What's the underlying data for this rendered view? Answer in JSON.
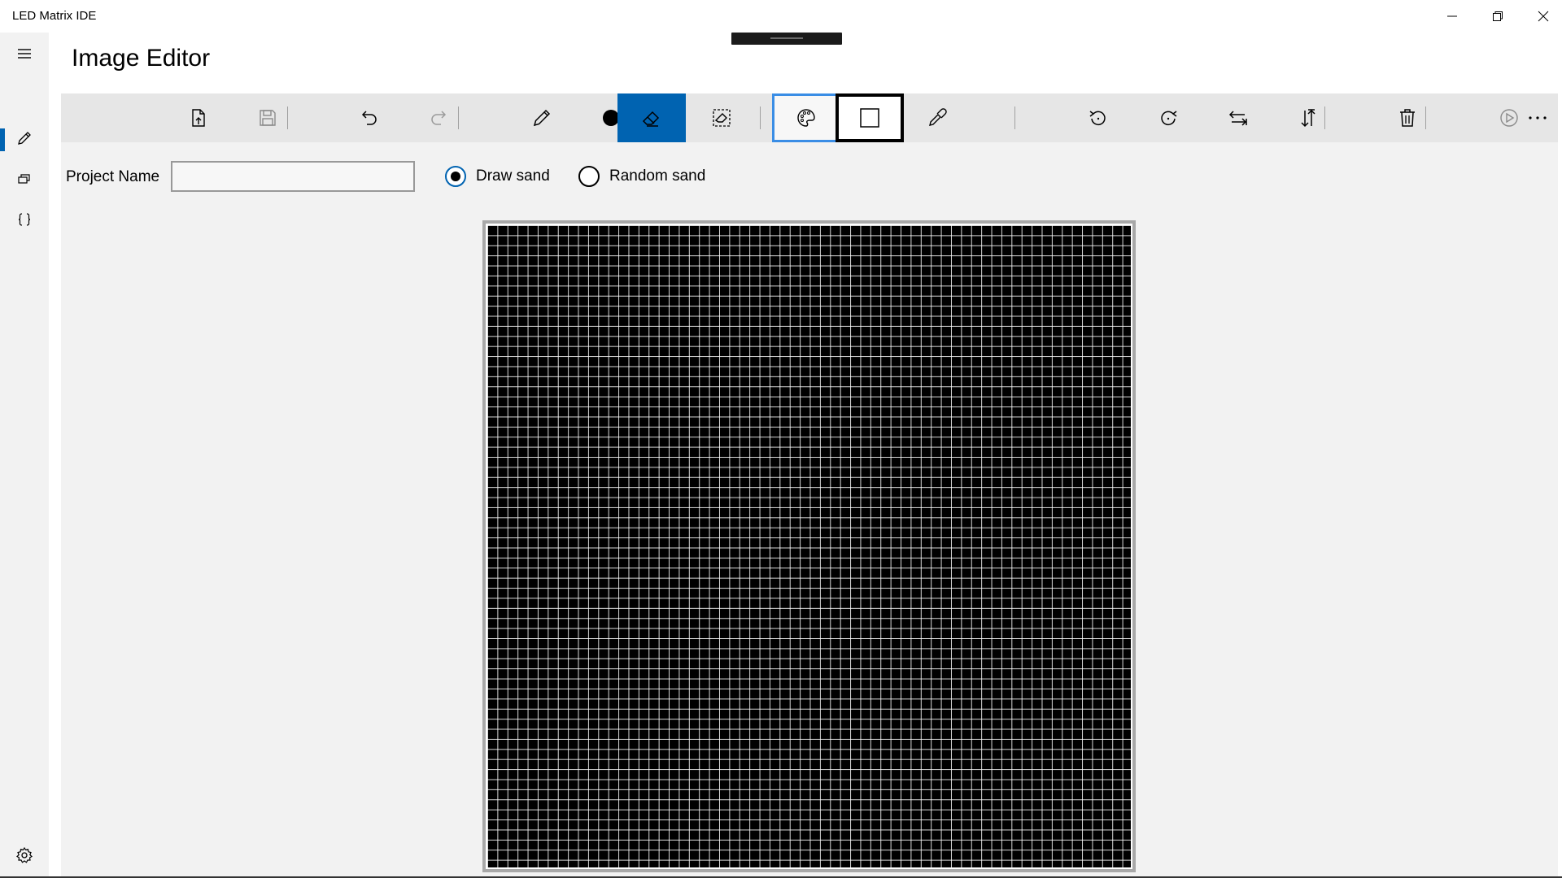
{
  "window": {
    "title": "LED Matrix IDE"
  },
  "nav": {
    "items": [
      {
        "name": "image-editor",
        "icon": "pencil-icon"
      },
      {
        "name": "animations",
        "icon": "layers-icon"
      },
      {
        "name": "code",
        "icon": "braces-icon"
      }
    ],
    "settings_icon": "gear-icon",
    "accent": "#0063b1"
  },
  "page": {
    "title": "Image Editor"
  },
  "toolbar": {
    "buttons": [
      {
        "name": "new-file",
        "icon": "new-file-icon"
      },
      {
        "name": "save",
        "icon": "save-icon",
        "disabled": true
      },
      {
        "name": "undo",
        "icon": "undo-icon"
      },
      {
        "name": "redo",
        "icon": "redo-icon",
        "disabled": true
      },
      {
        "name": "pencil",
        "icon": "pencil-icon"
      },
      {
        "name": "fill-dot",
        "icon": "filled-circle-icon"
      },
      {
        "name": "eraser",
        "icon": "eraser-icon",
        "active": true
      },
      {
        "name": "clear-selection",
        "icon": "erase-all-icon"
      },
      {
        "name": "palette",
        "icon": "palette-icon"
      },
      {
        "name": "current-color",
        "icon": "color-swatch-icon",
        "color": "#ffffff"
      },
      {
        "name": "eyedropper",
        "icon": "eyedropper-icon"
      },
      {
        "name": "rotate-left",
        "icon": "rotate-left-icon"
      },
      {
        "name": "rotate-right",
        "icon": "rotate-right-icon"
      },
      {
        "name": "flip-horizontal",
        "icon": "flip-horizontal-icon"
      },
      {
        "name": "flip-vertical",
        "icon": "flip-vertical-icon"
      },
      {
        "name": "delete",
        "icon": "trash-icon"
      },
      {
        "name": "play",
        "icon": "play-icon",
        "disabled": true
      },
      {
        "name": "more",
        "icon": "more-icon"
      }
    ]
  },
  "form": {
    "project_label": "Project Name",
    "project_value": "",
    "radio_draw": "Draw sand",
    "radio_random": "Random sand",
    "selected": "Draw sand"
  },
  "matrix": {
    "background": "#000000",
    "grid_color": "#ffffff"
  }
}
